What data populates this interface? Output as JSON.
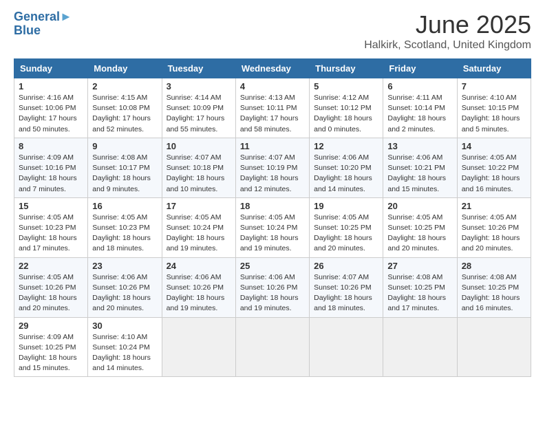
{
  "header": {
    "logo_line1": "General",
    "logo_line2": "Blue",
    "month": "June 2025",
    "location": "Halkirk, Scotland, United Kingdom"
  },
  "days_of_week": [
    "Sunday",
    "Monday",
    "Tuesday",
    "Wednesday",
    "Thursday",
    "Friday",
    "Saturday"
  ],
  "weeks": [
    [
      {
        "day": "1",
        "info": "Sunrise: 4:16 AM\nSunset: 10:06 PM\nDaylight: 17 hours\nand 50 minutes."
      },
      {
        "day": "2",
        "info": "Sunrise: 4:15 AM\nSunset: 10:08 PM\nDaylight: 17 hours\nand 52 minutes."
      },
      {
        "day": "3",
        "info": "Sunrise: 4:14 AM\nSunset: 10:09 PM\nDaylight: 17 hours\nand 55 minutes."
      },
      {
        "day": "4",
        "info": "Sunrise: 4:13 AM\nSunset: 10:11 PM\nDaylight: 17 hours\nand 58 minutes."
      },
      {
        "day": "5",
        "info": "Sunrise: 4:12 AM\nSunset: 10:12 PM\nDaylight: 18 hours\nand 0 minutes."
      },
      {
        "day": "6",
        "info": "Sunrise: 4:11 AM\nSunset: 10:14 PM\nDaylight: 18 hours\nand 2 minutes."
      },
      {
        "day": "7",
        "info": "Sunrise: 4:10 AM\nSunset: 10:15 PM\nDaylight: 18 hours\nand 5 minutes."
      }
    ],
    [
      {
        "day": "8",
        "info": "Sunrise: 4:09 AM\nSunset: 10:16 PM\nDaylight: 18 hours\nand 7 minutes."
      },
      {
        "day": "9",
        "info": "Sunrise: 4:08 AM\nSunset: 10:17 PM\nDaylight: 18 hours\nand 9 minutes."
      },
      {
        "day": "10",
        "info": "Sunrise: 4:07 AM\nSunset: 10:18 PM\nDaylight: 18 hours\nand 10 minutes."
      },
      {
        "day": "11",
        "info": "Sunrise: 4:07 AM\nSunset: 10:19 PM\nDaylight: 18 hours\nand 12 minutes."
      },
      {
        "day": "12",
        "info": "Sunrise: 4:06 AM\nSunset: 10:20 PM\nDaylight: 18 hours\nand 14 minutes."
      },
      {
        "day": "13",
        "info": "Sunrise: 4:06 AM\nSunset: 10:21 PM\nDaylight: 18 hours\nand 15 minutes."
      },
      {
        "day": "14",
        "info": "Sunrise: 4:05 AM\nSunset: 10:22 PM\nDaylight: 18 hours\nand 16 minutes."
      }
    ],
    [
      {
        "day": "15",
        "info": "Sunrise: 4:05 AM\nSunset: 10:23 PM\nDaylight: 18 hours\nand 17 minutes."
      },
      {
        "day": "16",
        "info": "Sunrise: 4:05 AM\nSunset: 10:23 PM\nDaylight: 18 hours\nand 18 minutes."
      },
      {
        "day": "17",
        "info": "Sunrise: 4:05 AM\nSunset: 10:24 PM\nDaylight: 18 hours\nand 19 minutes."
      },
      {
        "day": "18",
        "info": "Sunrise: 4:05 AM\nSunset: 10:24 PM\nDaylight: 18 hours\nand 19 minutes."
      },
      {
        "day": "19",
        "info": "Sunrise: 4:05 AM\nSunset: 10:25 PM\nDaylight: 18 hours\nand 20 minutes."
      },
      {
        "day": "20",
        "info": "Sunrise: 4:05 AM\nSunset: 10:25 PM\nDaylight: 18 hours\nand 20 minutes."
      },
      {
        "day": "21",
        "info": "Sunrise: 4:05 AM\nSunset: 10:26 PM\nDaylight: 18 hours\nand 20 minutes."
      }
    ],
    [
      {
        "day": "22",
        "info": "Sunrise: 4:05 AM\nSunset: 10:26 PM\nDaylight: 18 hours\nand 20 minutes."
      },
      {
        "day": "23",
        "info": "Sunrise: 4:06 AM\nSunset: 10:26 PM\nDaylight: 18 hours\nand 20 minutes."
      },
      {
        "day": "24",
        "info": "Sunrise: 4:06 AM\nSunset: 10:26 PM\nDaylight: 18 hours\nand 19 minutes."
      },
      {
        "day": "25",
        "info": "Sunrise: 4:06 AM\nSunset: 10:26 PM\nDaylight: 18 hours\nand 19 minutes."
      },
      {
        "day": "26",
        "info": "Sunrise: 4:07 AM\nSunset: 10:26 PM\nDaylight: 18 hours\nand 18 minutes."
      },
      {
        "day": "27",
        "info": "Sunrise: 4:08 AM\nSunset: 10:25 PM\nDaylight: 18 hours\nand 17 minutes."
      },
      {
        "day": "28",
        "info": "Sunrise: 4:08 AM\nSunset: 10:25 PM\nDaylight: 18 hours\nand 16 minutes."
      }
    ],
    [
      {
        "day": "29",
        "info": "Sunrise: 4:09 AM\nSunset: 10:25 PM\nDaylight: 18 hours\nand 15 minutes."
      },
      {
        "day": "30",
        "info": "Sunrise: 4:10 AM\nSunset: 10:24 PM\nDaylight: 18 hours\nand 14 minutes."
      },
      null,
      null,
      null,
      null,
      null
    ]
  ]
}
